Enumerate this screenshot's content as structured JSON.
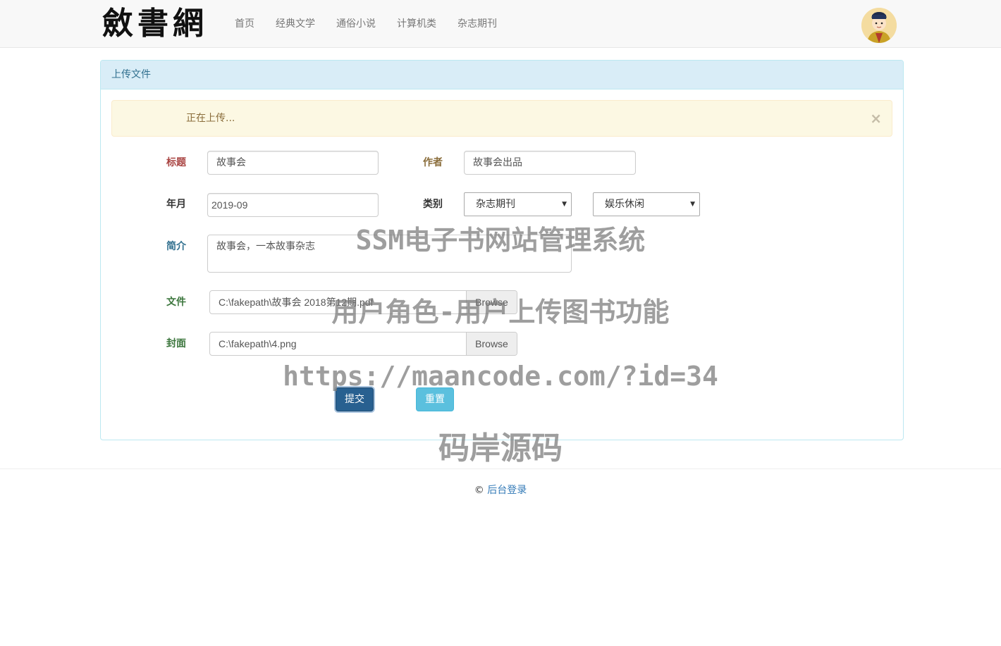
{
  "header": {
    "logo": "斂書網",
    "nav": [
      "首页",
      "经典文学",
      "通俗小说",
      "计算机类",
      "杂志期刊"
    ],
    "avatar_icon": "user-avatar-icon"
  },
  "panel": {
    "title": "上传文件",
    "alert": {
      "text": "正在上传...",
      "close": "×"
    }
  },
  "form": {
    "title_label": "标题",
    "title_value": "故事会",
    "author_label": "作者",
    "author_value": "故事会出品",
    "date_label": "年月",
    "date_value": "2019-09",
    "category_label": "类别",
    "category_value": "杂志期刊",
    "subcategory_value": "娱乐休闲",
    "intro_label": "简介",
    "intro_value": "故事会，一本故事杂志",
    "file_label": "文件",
    "file_value": "C:\\fakepath\\故事会 2018第12期.pdf",
    "cover_label": "封面",
    "cover_value": "C:\\fakepath\\4.png",
    "browse_label": "Browse",
    "submit_label": "提交",
    "reset_label": "重置"
  },
  "footer": {
    "copyright": "©",
    "link": "后台登录"
  },
  "watermark": {
    "line1": "SSM电子书网站管理系统",
    "line2": "用户角色-用户上传图书功能",
    "line3": "https://maancode.com/?id=34",
    "line4": "码岸源码"
  },
  "colors": {
    "panel_heading_bg": "#d9edf7",
    "alert_bg": "#fcf8e3",
    "primary": "#286090",
    "info": "#5bc0de",
    "link": "#337ab7"
  }
}
